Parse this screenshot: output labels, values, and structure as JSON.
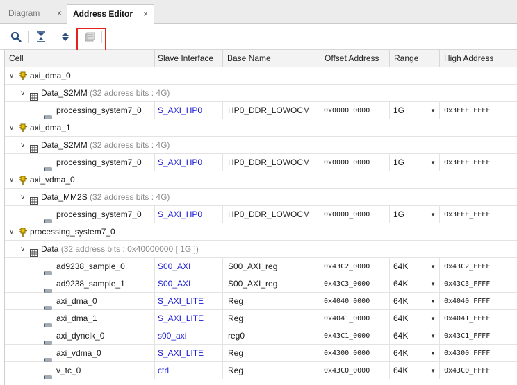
{
  "tabs": [
    {
      "label": "Diagram",
      "close": "×"
    },
    {
      "label": "Address Editor",
      "close": "×"
    }
  ],
  "toolbar": {
    "icons": [
      "search-icon",
      "collapse-all-icon",
      "expand-all-icon",
      "auto-assign-address-icon"
    ]
  },
  "columns": [
    "Cell",
    "Slave Interface",
    "Base Name",
    "Offset Address",
    "Range",
    "High Address"
  ],
  "rows": [
    {
      "type": "ip",
      "name": "axi_dma_0"
    },
    {
      "type": "space",
      "name": "Data_S2MM",
      "info": "(32 address bits : 4G)"
    },
    {
      "type": "seg",
      "cell": "processing_system7_0",
      "slave": "S_AXI_HP0",
      "base": "HP0_DDR_LOWOCM",
      "offset": "0x0000_0000",
      "range": "1G",
      "high": "0x3FFF_FFFF"
    },
    {
      "type": "ip",
      "name": "axi_dma_1"
    },
    {
      "type": "space",
      "name": "Data_S2MM",
      "info": "(32 address bits : 4G)"
    },
    {
      "type": "seg",
      "cell": "processing_system7_0",
      "slave": "S_AXI_HP0",
      "base": "HP0_DDR_LOWOCM",
      "offset": "0x0000_0000",
      "range": "1G",
      "high": "0x3FFF_FFFF"
    },
    {
      "type": "ip",
      "name": "axi_vdma_0"
    },
    {
      "type": "space",
      "name": "Data_MM2S",
      "info": "(32 address bits : 4G)"
    },
    {
      "type": "seg",
      "cell": "processing_system7_0",
      "slave": "S_AXI_HP0",
      "base": "HP0_DDR_LOWOCM",
      "offset": "0x0000_0000",
      "range": "1G",
      "high": "0x3FFF_FFFF"
    },
    {
      "type": "ip",
      "name": "processing_system7_0"
    },
    {
      "type": "space",
      "name": "Data",
      "info": "(32 address bits : 0x40000000 [ 1G ])"
    },
    {
      "type": "seg",
      "cell": "ad9238_sample_0",
      "slave": "S00_AXI",
      "base": "S00_AXI_reg",
      "offset": "0x43C2_0000",
      "range": "64K",
      "high": "0x43C2_FFFF"
    },
    {
      "type": "seg",
      "cell": "ad9238_sample_1",
      "slave": "S00_AXI",
      "base": "S00_AXI_reg",
      "offset": "0x43C3_0000",
      "range": "64K",
      "high": "0x43C3_FFFF"
    },
    {
      "type": "seg",
      "cell": "axi_dma_0",
      "slave": "S_AXI_LITE",
      "base": "Reg",
      "offset": "0x4040_0000",
      "range": "64K",
      "high": "0x4040_FFFF"
    },
    {
      "type": "seg",
      "cell": "axi_dma_1",
      "slave": "S_AXI_LITE",
      "base": "Reg",
      "offset": "0x4041_0000",
      "range": "64K",
      "high": "0x4041_FFFF"
    },
    {
      "type": "seg",
      "cell": "axi_dynclk_0",
      "slave": "s00_axi",
      "base": "reg0",
      "offset": "0x43C1_0000",
      "range": "64K",
      "high": "0x43C1_FFFF"
    },
    {
      "type": "seg",
      "cell": "axi_vdma_0",
      "slave": "S_AXI_LITE",
      "base": "Reg",
      "offset": "0x4300_0000",
      "range": "64K",
      "high": "0x4300_FFFF"
    },
    {
      "type": "seg",
      "cell": "v_tc_0",
      "slave": "ctrl",
      "base": "Reg",
      "offset": "0x43C0_0000",
      "range": "64K",
      "high": "0x43C0_FFFF"
    }
  ],
  "glyphs": {
    "expanded": "∨",
    "dropdown": "▼"
  },
  "colors": {
    "slave_link": "#1a1ad6",
    "ip_icon": "#e0b800",
    "highlight_border": "#e3241f"
  }
}
